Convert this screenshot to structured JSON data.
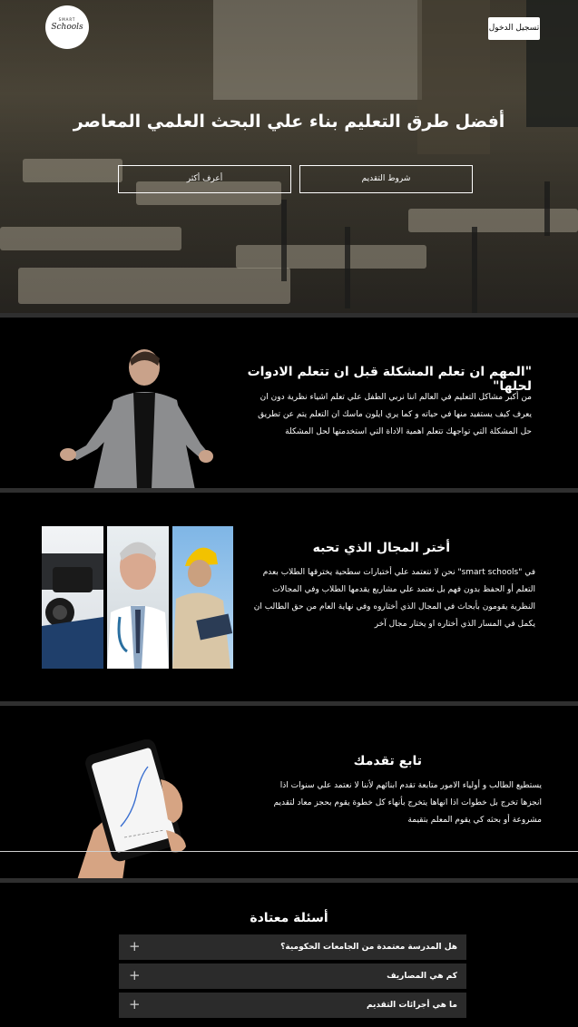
{
  "header": {
    "logo_small": "SMART",
    "logo_name": "Schools",
    "login_label": "تسجيل الدخول"
  },
  "hero": {
    "title": "أفضل طرق التعليم بناء علي البحث العلمي المعاصر",
    "learn_more_label": "أعرف أكثر",
    "terms_label": "شروط التقديم"
  },
  "section_problem": {
    "title": "\"المهم ان تعلم المشكلة قبل ان تتعلم الادوات لحلها\"",
    "lines": [
      "من أكبر مشاكل التعليم في العالم اننا نربي الطفل علي تعلم اشياء نظرية دون ان",
      "يعرف كيف يستفيد منها في حياته و كما يري ايلون ماسك ان التعلم يتم عن تطريق",
      "حل المشكلة التي تواجهك تتعلم اهمية الاداة التي استخدمتها لحل المشكلة"
    ]
  },
  "section_field": {
    "title": "أختر المجال الذي تحبه",
    "lines": [
      "في \"smart schools\" نحن لا نتعتمد علي أختبارات سطحية يخترقها الطلاب بعدم",
      "التعلم أو الحفظ بدون فهم بل نعتمد علي مشاريع يقدمها الطلاب وفي المجالات",
      "النظرية يقومون بأبحاث في المجال الذي أختاروه وفي نهاية العام من حق الطالب ان",
      "يكمل في المسار الذي أختاره او يختار مجال آخر"
    ]
  },
  "section_progress": {
    "title": "تابع تقدمك",
    "lines": [
      "يستطيع الطالب و أولياء الامور متابعة تقدم ابنائهم لأننا لا نعتمد علي سنوات اذا",
      "انجزها تخرج بل خطوات اذا انهاها يتخرج بأنهاء كل خطوة يقوم بحجز معاد لتقديم",
      "مشروعة أو بحثه كي يقوم المعلم بتقيمة"
    ]
  },
  "faq": {
    "title": "أسئلة معتادة",
    "items": [
      {
        "question": "هل المدرسة معتمدة من الجامعات الحكومية؟",
        "icon": "plus-icon"
      },
      {
        "question": "كم هي المصاريف",
        "icon": "plus-icon"
      },
      {
        "question": "ما هي أجرائات التقديم",
        "icon": "plus-icon"
      }
    ]
  }
}
